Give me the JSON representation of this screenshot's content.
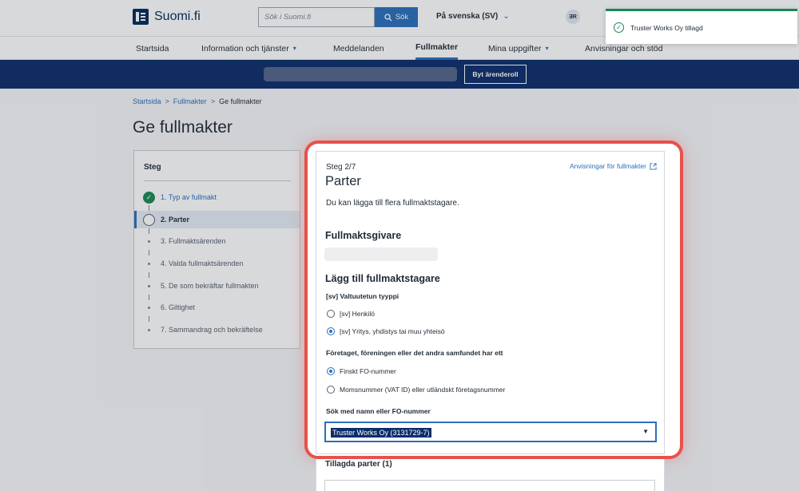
{
  "header": {
    "logo_text": "Suomi.fi",
    "search_placeholder": "Sök i Suomi.fi",
    "search_button": "Sök",
    "language": "På svenska (SV)",
    "avatar_initials": "ƎR"
  },
  "nav": {
    "items": [
      {
        "label": "Startsida"
      },
      {
        "label": "Information och tjänster"
      },
      {
        "label": "Meddelanden"
      },
      {
        "label": "Fullmakter"
      },
      {
        "label": "Mina uppgifter"
      },
      {
        "label": "Anvisningar och stöd"
      }
    ],
    "active": "Fullmakter"
  },
  "band": {
    "role_button": "Byt ärenderoll"
  },
  "breadcrumb": {
    "items": [
      "Startsida",
      "Fullmakter",
      "Ge fullmakter"
    ]
  },
  "page_title": "Ge fullmakter",
  "steps": {
    "title": "Steg",
    "items": [
      {
        "label": "1. Typ av fullmakt",
        "state": "done"
      },
      {
        "label": "2. Parter",
        "state": "current"
      },
      {
        "label": "3. Fullmaktsärenden",
        "state": "todo"
      },
      {
        "label": "4. Valda fullmaktsärenden",
        "state": "todo"
      },
      {
        "label": "5. De som bekräftar fullmakten",
        "state": "todo"
      },
      {
        "label": "6. Giltighet",
        "state": "todo"
      },
      {
        "label": "7. Sammandrag och bekräftelse",
        "state": "todo"
      }
    ]
  },
  "form": {
    "step_counter": "Steg 2/7",
    "title": "Parter",
    "help_link": "Anvisningar för fullmakter",
    "intro": "Du kan lägga till flera fullmaktstagare.",
    "giver_heading": "Fullmaktsgivare",
    "add_heading": "Lägg till fullmaktstagare",
    "type_label": "[sv] Valtuutetun tyyppi",
    "type_options": [
      "[sv] Henkilö",
      "[sv] Yritys, yhdistys tai muu yhteisö"
    ],
    "type_selected": "[sv] Yritys, yhdistys tai muu yhteisö",
    "id_label": "Företaget, föreningen eller det andra samfundet har ett",
    "id_options": [
      "Finskt FO-nummer",
      "Momsnummer (VAT ID) eller utländskt företagsnummer"
    ],
    "id_selected": "Finskt FO-nummer",
    "search_label": "Sök med namn eller FO-nummer",
    "search_value": "Truster Works Oy (3131729-7)",
    "added_heading": "Tillagda parter (1)"
  },
  "toast": {
    "message": "Truster Works Oy tillagd",
    "status_color": "#1a8754"
  },
  "colors": {
    "brand": "#002a5c",
    "accent": "#2a6ebb",
    "band": "#0b2d6b",
    "highlight": "#e8514a"
  }
}
